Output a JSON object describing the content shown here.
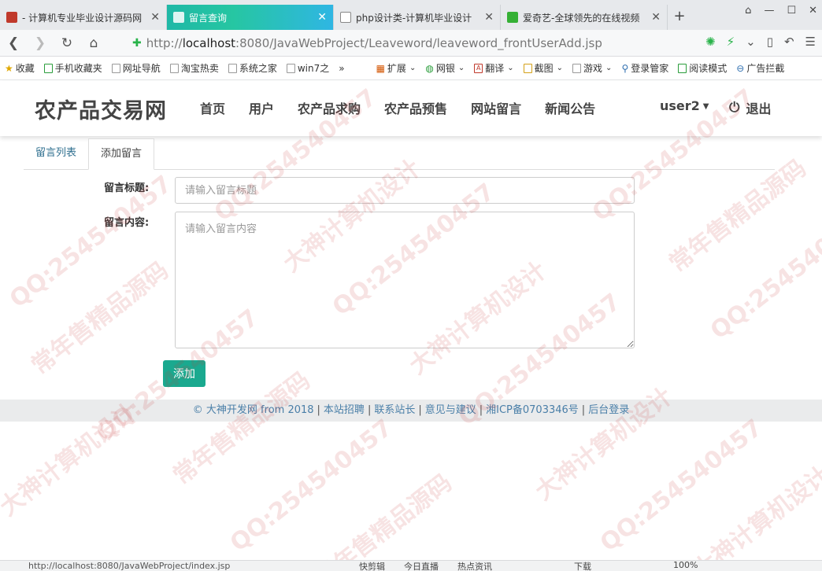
{
  "browser": {
    "tabs": [
      {
        "title": "- 计算机专业毕业设计源码网",
        "favicon_color": "#c0392b"
      },
      {
        "title": "留言查询",
        "favicon_color": "#ffffff",
        "active": true
      },
      {
        "title": "php设计类-计算机毕业设计",
        "favicon_color": "#ffffff"
      },
      {
        "title": "爱奇艺-全球领先的在线视频",
        "favicon_color": "#35b035"
      }
    ],
    "new_tab": "+",
    "address": {
      "prefix": "http://",
      "host": "localhost",
      "rest": ":8080/JavaWebProject/Leaveword/leaveword_frontUserAdd.jsp"
    },
    "bookmarks": [
      "收藏",
      "手机收藏夹",
      "网址导航",
      "淘宝热卖",
      "系统之家",
      "win7之",
      "»",
      "扩展",
      "网银",
      "翻译",
      "截图",
      "游戏",
      "登录管家",
      "阅读模式",
      "广告拦截"
    ],
    "status_url": "http://localhost:8080/JavaWebProject/index.jsp",
    "status_items": [
      "快剪辑",
      "今日直播",
      "热点资讯",
      "下载",
      "100%"
    ]
  },
  "site": {
    "brand": "农产品交易网",
    "nav": [
      "首页",
      "用户",
      "农产品求购",
      "农产品预售",
      "网站留言",
      "新闻公告"
    ],
    "user": "user2",
    "logout": "退出"
  },
  "content": {
    "tabs": [
      {
        "label": "留言列表"
      },
      {
        "label": "添加留言",
        "active": true
      }
    ],
    "form": {
      "title_label": "留言标题:",
      "title_placeholder": "请输入留言标题",
      "content_label": "留言内容:",
      "content_placeholder": "请输入留言内容",
      "submit_label": "添加"
    }
  },
  "footer": {
    "links": [
      "© 大神开发网 from 2018",
      "本站招聘",
      "联系站长",
      "意见与建议",
      "湘ICP备0703346号",
      "后台登录"
    ]
  },
  "watermarks": [
    "QQ:254540457",
    "常年售精品源码",
    "大神计算机设计"
  ],
  "colors": {
    "accent": "#1aa98f",
    "active_tab_gradient_start": "#1fb8a6",
    "active_tab_gradient_end": "#2fb6e3",
    "link": "#4a7fa8"
  }
}
